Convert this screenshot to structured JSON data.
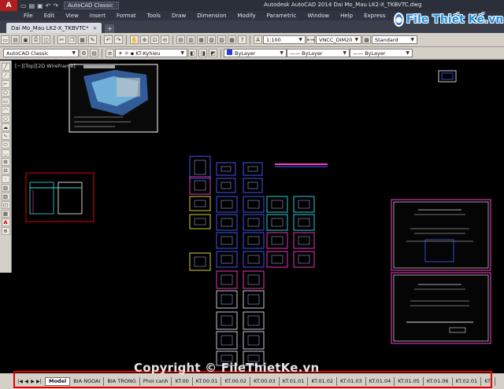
{
  "title_bar": {
    "logo": "A",
    "workspace": "AutoCAD Classic",
    "title": "Autodesk AutoCAD 2014   Dai Mo_Mau LK2-X_TKBVTC.dwg",
    "watermark_logo": "File Thiết Kế.vn"
  },
  "menu": [
    "File",
    "Edit",
    "View",
    "Insert",
    "Format",
    "Tools",
    "Draw",
    "Dimension",
    "Modify",
    "Parametric",
    "Window",
    "Help",
    "Express"
  ],
  "document_tab": {
    "label": "Dai Mo_Mau LK2-X_TKBVTC*",
    "close": "×",
    "add": "+"
  },
  "toolbar1": {
    "annotation_scale": "1:100",
    "dimstyle": "VNCC_DIM20",
    "textstyle": "Standard"
  },
  "toolbar2": {
    "workspace": "AutoCAD Classic",
    "layer": "KT-Kyhieu",
    "color": "ByLayer",
    "linetype": "ByLayer",
    "lineweight": "ByLayer"
  },
  "viewport_label": "[−][Top][2D Wireframe]",
  "watermark": "Copyright © FileThietKe.vn",
  "layout_tabs": {
    "tabs": [
      "Model",
      "BIA NGOAI",
      "BIA TRONG",
      "Phoi canh",
      "KT.00",
      "KT.00.01",
      "KT.00.02",
      "KT.00.03",
      "KT.01.01",
      "KT.01.02",
      "KT.01.03",
      "KT.01.04",
      "KT.01.05",
      "KT.01.06",
      "KT.02.01",
      "KT."
    ],
    "active": "Model"
  },
  "colors": {
    "canvas": "#000000",
    "annotation_box": "#e00000",
    "frame_magenta": "#ff3cc8",
    "frame_cyan": "#33e0e0",
    "frame_yellow": "#e8e040",
    "frame_blue": "#4a5cff"
  }
}
